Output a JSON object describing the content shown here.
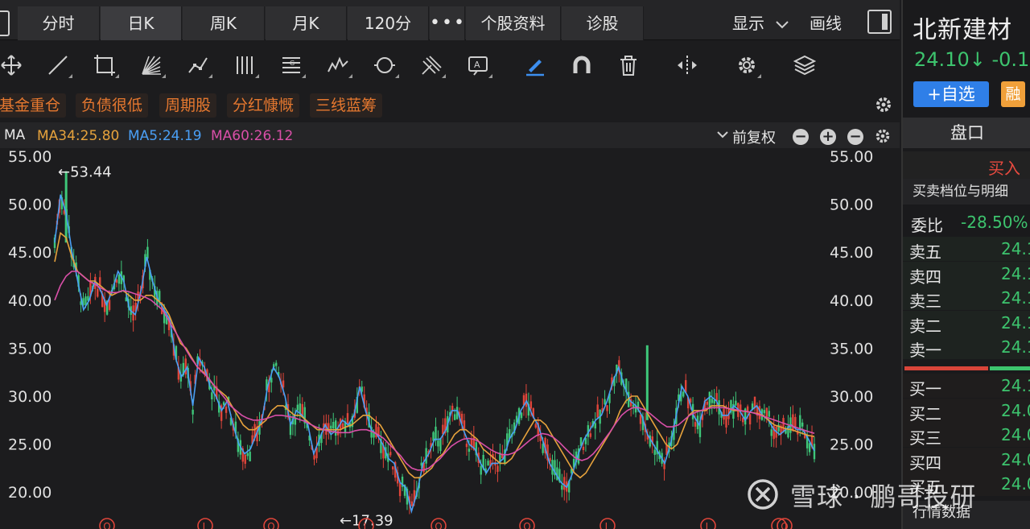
{
  "tabs": {
    "items": [
      "分时",
      "日K",
      "周K",
      "月K",
      "120分",
      "•••",
      "个股资料",
      "诊股"
    ],
    "active": "日K"
  },
  "toolbar_right": {
    "display": "显示",
    "draw": "画线"
  },
  "tools": [
    "move-icon",
    "line-icon",
    "rect-icon",
    "fan-icon",
    "pattern-icon",
    "parallel-lines-icon",
    "gann-icon",
    "wave-icon",
    "cycle-icon",
    "pitchfork-icon",
    "text-icon",
    "pen-icon",
    "magnet-icon",
    "trash-icon",
    "split-icon",
    "gear-icon",
    "layers-icon"
  ],
  "tags": [
    "基金重仓",
    "负债很低",
    "周期股",
    "分红慷慨",
    "三线蓝筹"
  ],
  "ma_legend": {
    "label": "MA",
    "items": [
      {
        "text": "MA34:25.80",
        "color": "#e6a23c"
      },
      {
        "text": "MA5:24.19",
        "color": "#4a9ff5"
      },
      {
        "text": "MA60:26.12",
        "color": "#d94fa8"
      }
    ],
    "adjust": "前复权",
    "buttons": [
      "−",
      "+",
      "−"
    ]
  },
  "chart_data": {
    "type": "line",
    "ylim": [
      17.5,
      55
    ],
    "y_ticks": [
      "55.00",
      "50.00",
      "45.00",
      "40.00",
      "35.00",
      "30.00",
      "25.00",
      "20.00"
    ],
    "annotations": [
      {
        "text": "←53.44",
        "value": 53.44
      },
      {
        "text": "←17.39",
        "value": 17.39
      }
    ],
    "series": [
      {
        "name": "MA5",
        "color": "#4a9ff5",
        "values": [
          46,
          51,
          49,
          45,
          42,
          39,
          40,
          42,
          41,
          39.5,
          41,
          43,
          42,
          39,
          38.5,
          41,
          44.5,
          42,
          40,
          39,
          38,
          34,
          32,
          33,
          29,
          34,
          33,
          31,
          30,
          28.5,
          29.5,
          27,
          25,
          24,
          24.5,
          26,
          27.5,
          31,
          33,
          32,
          30,
          27,
          28.5,
          28,
          27,
          24,
          25.5,
          27,
          26,
          26.5,
          27.5,
          27,
          28,
          31,
          28.5,
          26.5,
          26,
          25,
          23.5,
          23,
          21,
          20.5,
          18,
          20,
          23,
          24,
          25.5,
          25.5,
          26.5,
          28.5,
          28.5,
          26.5,
          25,
          24.5,
          23,
          22,
          23,
          23,
          23.5,
          25.5,
          26.5,
          28.5,
          29.5,
          28,
          27,
          25,
          23,
          22,
          21,
          20.5,
          22,
          24,
          25.5,
          26.5,
          27.5,
          28,
          29.5,
          31.5,
          33,
          31,
          29.5,
          29,
          28,
          26,
          25,
          24,
          23,
          25,
          28,
          31,
          30,
          28,
          27,
          29.5,
          30,
          29.5,
          28,
          28,
          29,
          28.5,
          27.5,
          28.5,
          29,
          28,
          27.5,
          26.5,
          26,
          26.5,
          27,
          26.5,
          26.5,
          25.5,
          24.3
        ]
      },
      {
        "name": "MA34",
        "color": "#e6a23c",
        "values": [
          44,
          47,
          46.5,
          44.5,
          43,
          42.5,
          42,
          42,
          41.5,
          41,
          40.5,
          40.8,
          41,
          40.5,
          40,
          40,
          40.5,
          40.5,
          40,
          39.5,
          38.5,
          37,
          35.5,
          35,
          34,
          33,
          32.5,
          31.8,
          31,
          30.5,
          30,
          29,
          28,
          27,
          26.5,
          26.5,
          27,
          27.5,
          28.5,
          29,
          29,
          28.5,
          28,
          28,
          27.5,
          27,
          26.5,
          26.5,
          26.5,
          26.5,
          26.5,
          26.8,
          27,
          27.5,
          28,
          28,
          27.5,
          27,
          26,
          25,
          24,
          23,
          22,
          21.5,
          21.5,
          22,
          22.5,
          23.5,
          24,
          25,
          26,
          26.5,
          26.5,
          26,
          25.5,
          24.5,
          24,
          23.5,
          23,
          23,
          23.5,
          24.5,
          25.5,
          26.5,
          27.5,
          27.5,
          27,
          26,
          25,
          24,
          23,
          22,
          21.5,
          22,
          23,
          24,
          25,
          26,
          27,
          28.5,
          29.5,
          30,
          30,
          29,
          28,
          27,
          26,
          25,
          24.5,
          25,
          26.5,
          28,
          28.5,
          28.5,
          28.5,
          29,
          29,
          29,
          28.7,
          28.5,
          28.5,
          28.4,
          28.3,
          28.2,
          28,
          27.5,
          27,
          26.8,
          26.6,
          26.5,
          26.3,
          26.1,
          25.9,
          25.8
        ]
      },
      {
        "name": "MA60",
        "color": "#d94fa8",
        "values": [
          40,
          41.5,
          42.5,
          43,
          43,
          42.5,
          42,
          41.7,
          41.3,
          41,
          40.8,
          40.8,
          41,
          40.9,
          40.7,
          40.5,
          40.3,
          40,
          39.5,
          39,
          38,
          37,
          36,
          35,
          34,
          33.2,
          32.5,
          32,
          31.2,
          30.5,
          29.8,
          29,
          28.5,
          28,
          27.7,
          27.5,
          27.5,
          27.6,
          27.8,
          28,
          28,
          27.9,
          27.8,
          27.6,
          27.4,
          27.1,
          26.8,
          26.6,
          26.4,
          26.3,
          26.2,
          26.2,
          26.2,
          26.4,
          26.5,
          26.5,
          26.3,
          26,
          25.6,
          25,
          24.4,
          23.8,
          23,
          22.5,
          22.3,
          22.3,
          22.5,
          23,
          23.5,
          24.2,
          24.8,
          25.2,
          25.5,
          25.6,
          25.5,
          25.2,
          24.8,
          24.4,
          24.1,
          23.9,
          23.9,
          24.1,
          24.5,
          25,
          25.5,
          25.9,
          26.1,
          26,
          25.7,
          25.2,
          24.6,
          24,
          23.5,
          23.3,
          23.5,
          24,
          24.7,
          25.5,
          26.3,
          27.2,
          28,
          28.5,
          28.8,
          28.8,
          28.6,
          28.2,
          27.7,
          27.2,
          26.8,
          26.8,
          27,
          27.5,
          28,
          28.3,
          28.5,
          28.7,
          28.8,
          28.8,
          28.8,
          28.7,
          28.6,
          28.5,
          28.4,
          28.3,
          28.1,
          27.9,
          27.7,
          27.5,
          27.3,
          27.1,
          26.9,
          26.7,
          26.5,
          26.3,
          26.12
        ]
      }
    ]
  },
  "markers": [
    "Q",
    "L",
    "Q",
    "L",
    "Q",
    "Q",
    "L",
    "L",
    "L",
    "Q"
  ],
  "panel": {
    "name": "北新建材",
    "price": "24.10↓ -0.1",
    "watch": "+自选",
    "margin": "融",
    "quote_tab": "盘口",
    "buy": "买入",
    "detail": "买卖档位与明细",
    "ratio_label": "委比",
    "ratio_value": "-28.50%",
    "sells": [
      {
        "label": "卖五",
        "price": "24.1"
      },
      {
        "label": "卖四",
        "price": "24.1"
      },
      {
        "label": "卖三",
        "price": "24.1"
      },
      {
        "label": "卖二",
        "price": "24.1"
      },
      {
        "label": "卖一",
        "price": "24.1"
      }
    ],
    "buys": [
      {
        "label": "买一",
        "price": "24.1"
      },
      {
        "label": "买二",
        "price": "24.0"
      },
      {
        "label": "买三",
        "price": "24.0"
      },
      {
        "label": "买四",
        "price": "24.0"
      },
      {
        "label": "买五",
        "price": "24.0"
      }
    ],
    "market_data": "行情数据"
  },
  "watermark": "雪球 · 鹏哥投研"
}
